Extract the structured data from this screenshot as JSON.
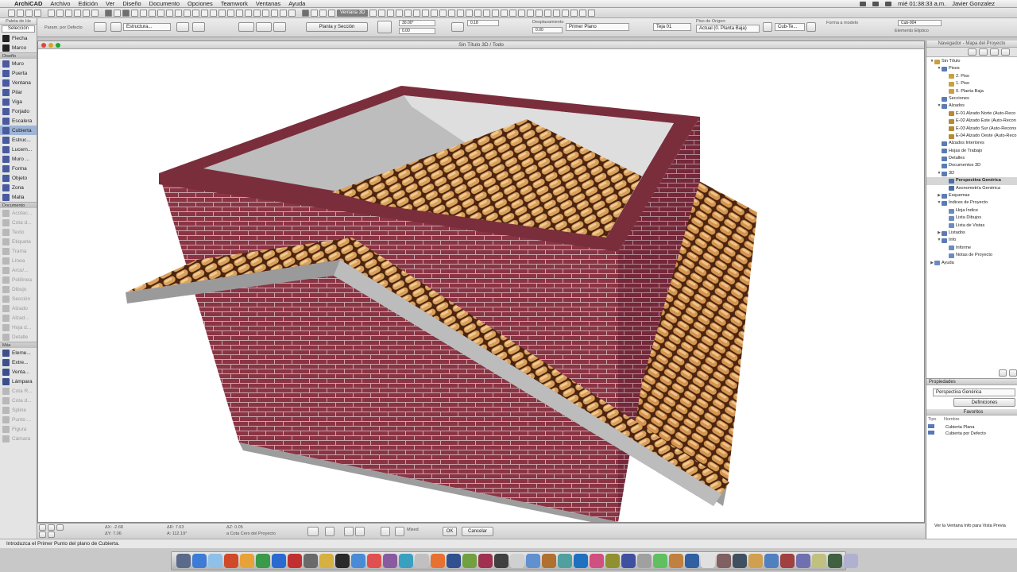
{
  "menubar": {
    "app": "ArchiCAD",
    "items": [
      "Archivo",
      "Edición",
      "Ver",
      "Diseño",
      "Documento",
      "Opciones",
      "Teamwork",
      "Ventanas",
      "Ayuda"
    ],
    "clock": "mié 01:38:33 a.m.",
    "user": "Javier Gonzalez"
  },
  "toolbar1": {
    "view_name": "Ventana 3D"
  },
  "infobox": {
    "palette_label": "Param. por Defecto",
    "structure": "Estructura...",
    "plan_section": "Planta y Sección",
    "angle_value": "30.00°",
    "thickness_value": "0.00",
    "thickness2_value": "0.18",
    "offset_label": "Desplazamiento",
    "offset_value": "0.00",
    "material": "Primer Plano",
    "roof_layer": "Teja 01",
    "origin_label": "Piso de Origen:",
    "origin_value": "Actual (0. Planta Baja)",
    "layer": "Cub-Te...",
    "layer2": "Cub-004",
    "model_label": "Forma a modelo",
    "ellipse_label": "Elemento Elíptico"
  },
  "toolbox": {
    "header": "Paleta de He",
    "select_label": "Selección",
    "sections": {
      "top": [
        {
          "label": "Flecha",
          "icon": "arrow-icon",
          "color": "#222222"
        },
        {
          "label": "Marco",
          "icon": "marquee-icon",
          "color": "#222222"
        }
      ],
      "diseno_title": "Diseño",
      "diseno": [
        {
          "label": "Muro",
          "icon": "wall-icon",
          "color": "#4a5aa0"
        },
        {
          "label": "Puerta",
          "icon": "door-icon",
          "color": "#4a5aa0"
        },
        {
          "label": "Ventana",
          "icon": "window-icon",
          "color": "#4a5aa0"
        },
        {
          "label": "Pilar",
          "icon": "column-icon",
          "color": "#4a5aa0"
        },
        {
          "label": "Viga",
          "icon": "beam-icon",
          "color": "#4a5aa0"
        },
        {
          "label": "Forjado",
          "icon": "slab-icon",
          "color": "#4a5aa0"
        },
        {
          "label": "Escalera",
          "icon": "stair-icon",
          "color": "#4a5aa0"
        },
        {
          "label": "Cubierta",
          "icon": "roof-icon",
          "color": "#4a5aa0",
          "active": true
        },
        {
          "label": "Estruc...",
          "icon": "shell-icon",
          "color": "#4a5aa0"
        },
        {
          "label": "Lucern...",
          "icon": "skylight-icon",
          "color": "#4a5aa0"
        },
        {
          "label": "Muro ...",
          "icon": "curtain-wall-icon",
          "color": "#4a5aa0"
        },
        {
          "label": "Forma",
          "icon": "morph-icon",
          "color": "#4a5aa0"
        },
        {
          "label": "Objeto",
          "icon": "object-icon",
          "color": "#4a5aa0"
        },
        {
          "label": "Zona",
          "icon": "zone-icon",
          "color": "#4a5aa0"
        },
        {
          "label": "Malla",
          "icon": "mesh-icon",
          "color": "#4a5aa0"
        }
      ],
      "documento_title": "Documento",
      "documento": [
        {
          "label": "Acotac...",
          "icon": "dimension-icon"
        },
        {
          "label": "Cota d...",
          "icon": "level-dimension-icon"
        },
        {
          "label": "Texto",
          "icon": "text-icon"
        },
        {
          "label": "Etiqueta",
          "icon": "label-icon"
        },
        {
          "label": "Trama",
          "icon": "fill-icon"
        },
        {
          "label": "Línea",
          "icon": "line-icon"
        },
        {
          "label": "Arco/...",
          "icon": "arc-icon"
        },
        {
          "label": "Polilínea",
          "icon": "polyline-icon"
        },
        {
          "label": "Dibujo",
          "icon": "drawing-icon"
        },
        {
          "label": "Sección",
          "icon": "section-icon"
        },
        {
          "label": "Alzado",
          "icon": "elevation-icon"
        },
        {
          "label": "Alzad...",
          "icon": "interior-elevation-icon"
        },
        {
          "label": "Hoja d...",
          "icon": "worksheet-icon"
        },
        {
          "label": "Detalle",
          "icon": "detail-icon"
        }
      ],
      "mas_title": "Más",
      "mas": [
        {
          "label": "Eleme...",
          "icon": "wall-end-icon",
          "enabled": true
        },
        {
          "label": "Extre...",
          "icon": "corner-window-icon",
          "enabled": true
        },
        {
          "label": "Venta...",
          "icon": "skylight2-icon",
          "enabled": true
        },
        {
          "label": "Lámpara",
          "icon": "lamp-icon",
          "enabled": true
        },
        {
          "label": "Cota R...",
          "icon": "radial-dimension-icon",
          "enabled": false
        },
        {
          "label": "Cota d...",
          "icon": "angle-dimension-icon",
          "enabled": false
        },
        {
          "label": "Spline",
          "icon": "spline-icon",
          "enabled": false
        },
        {
          "label": "Punto ...",
          "icon": "hotspot-icon",
          "enabled": false
        },
        {
          "label": "Figura",
          "icon": "figure-icon",
          "enabled": false
        },
        {
          "label": "Cámara",
          "icon": "camera-icon",
          "enabled": false
        }
      ]
    }
  },
  "window3d": {
    "title": "Sin Título 3D / Todo"
  },
  "coordbar": {
    "dx": "ΔX: -2.68",
    "dy": "ΔY: 7.06",
    "dr": "ΔR: 7.63",
    "da": "A: 112.19°",
    "dz": "ΔZ: 0.05",
    "ref": "a Cota Cero del Proyecto",
    "mixed": "Mixed",
    "ok": "OK",
    "cancel": "Cancelar"
  },
  "statusbar": {
    "text": "Introduzca el Primer Punto del plano de Cubierta."
  },
  "navigator": {
    "title": "Navegador - Mapa del Proyecto",
    "tree": [
      {
        "label": "Sin Título",
        "level": 0,
        "arrow": "▼",
        "icon": "project-icon"
      },
      {
        "label": "Pisos",
        "level": 1,
        "arrow": "▼",
        "icon": "folder-icon"
      },
      {
        "label": "2. Piso",
        "level": 2,
        "arrow": "",
        "icon": "story-icon"
      },
      {
        "label": "1. Piso",
        "level": 2,
        "arrow": "",
        "icon": "story-icon"
      },
      {
        "label": "0. Planta Baja",
        "level": 2,
        "arrow": "",
        "icon": "story-icon"
      },
      {
        "label": "Secciones",
        "level": 1,
        "arrow": "",
        "icon": "folder-icon"
      },
      {
        "label": "Alzados",
        "level": 1,
        "arrow": "▼",
        "icon": "folder-icon"
      },
      {
        "label": "E-01 Alzado Norte (Auto-Reco",
        "level": 2,
        "arrow": "",
        "icon": "elevation-view-icon"
      },
      {
        "label": "E-02 Alzado Este (Auto-Recon",
        "level": 2,
        "arrow": "",
        "icon": "elevation-view-icon"
      },
      {
        "label": "E-03 Alzado Sur (Auto-Recons",
        "level": 2,
        "arrow": "",
        "icon": "elevation-view-icon"
      },
      {
        "label": "E-04 Alzado Oeste (Auto-Reco",
        "level": 2,
        "arrow": "",
        "icon": "elevation-view-icon"
      },
      {
        "label": "Alzados Interiores",
        "level": 1,
        "arrow": "",
        "icon": "folder-icon"
      },
      {
        "label": "Hojas de Trabajo",
        "level": 1,
        "arrow": "",
        "icon": "folder-icon"
      },
      {
        "label": "Detalles",
        "level": 1,
        "arrow": "",
        "icon": "folder-icon"
      },
      {
        "label": "Documentos 3D",
        "level": 1,
        "arrow": "",
        "icon": "folder-icon"
      },
      {
        "label": "3D",
        "level": 1,
        "arrow": "▼",
        "icon": "folder-icon"
      },
      {
        "label": "Perspectiva Genérica",
        "level": 2,
        "arrow": "",
        "icon": "perspective-icon",
        "selected": true
      },
      {
        "label": "Axonometría Genérica",
        "level": 2,
        "arrow": "",
        "icon": "axonometry-icon"
      },
      {
        "label": "Esquemas",
        "level": 1,
        "arrow": "▶",
        "icon": "folder-icon"
      },
      {
        "label": "Índices de Proyecto",
        "level": 1,
        "arrow": "▼",
        "icon": "folder-icon"
      },
      {
        "label": "Hoja Índice",
        "level": 2,
        "arrow": "",
        "icon": "list-icon"
      },
      {
        "label": "Lista Dibujos",
        "level": 2,
        "arrow": "",
        "icon": "list-icon"
      },
      {
        "label": "Lista de Vistas",
        "level": 2,
        "arrow": "",
        "icon": "list-icon"
      },
      {
        "label": "Listados",
        "level": 1,
        "arrow": "▶",
        "icon": "folder-icon"
      },
      {
        "label": "Info",
        "level": 1,
        "arrow": "▼",
        "icon": "folder-icon"
      },
      {
        "label": "Informe",
        "level": 2,
        "arrow": "",
        "icon": "report-icon"
      },
      {
        "label": "Notas de Proyecto",
        "level": 2,
        "arrow": "",
        "icon": "notes-icon"
      },
      {
        "label": "Ayuda",
        "level": 0,
        "arrow": "▶",
        "icon": "help-icon"
      }
    ],
    "properties_title": "Propiedades",
    "properties_value": "Perspectiva Genérica",
    "definitions_button": "Definiciones",
    "favorites_title": "Favoritos",
    "favorites_col_type": "Tipo",
    "favorites_col_name": "Nombre",
    "favorites": [
      "Cubierta Plana",
      "Cubierta por Defecto"
    ],
    "info_text": "Ver la Ventana Info para Vista Previa"
  },
  "colors": {
    "brick": "#8a3444",
    "tile": "#d79a55",
    "concrete": "#9d9d9d"
  }
}
